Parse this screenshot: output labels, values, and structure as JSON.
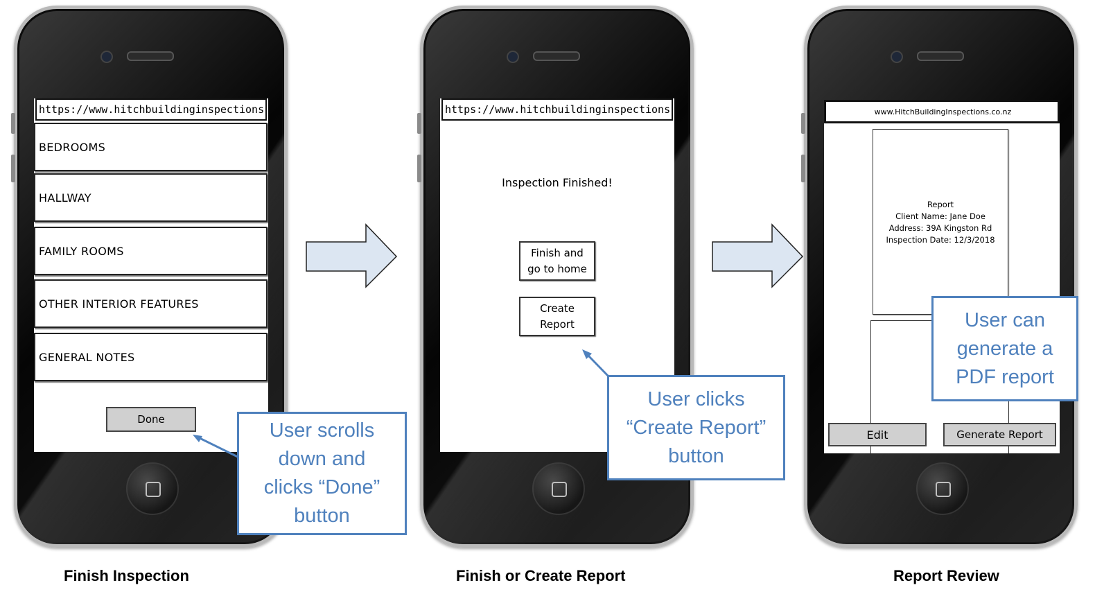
{
  "screens": [
    {
      "caption": "Finish Inspection",
      "url": "https://www.hitchbuildinginspections.co.n",
      "menu_items": [
        "BEDROOMS",
        "HALLWAY",
        "FAMILY ROOMS",
        "OTHER INTERIOR FEATURES",
        "GENERAL NOTES"
      ],
      "done_label": "Done",
      "callout": "User scrolls down and clicks “Done” button"
    },
    {
      "caption": "Finish or Create Report",
      "url": "https://www.hitchbuildinginspections.co.n",
      "status_text": "Inspection Finished!",
      "finish_label": "Finish and go to home",
      "create_label": "Create Report",
      "callout": "User clicks “Create Report” button"
    },
    {
      "caption": "Report Review",
      "url": "www.HitchBuildingInspections.co.nz",
      "report": {
        "title": "Report",
        "client": "Client Name: Jane Doe",
        "address": "Address: 39A Kingston Rd",
        "date": "Inspection Date: 12/3/2018"
      },
      "edit_label": "Edit",
      "generate_label": "Generate Report",
      "callout": "User can generate a PDF report"
    }
  ],
  "colors": {
    "callout_border": "#4f81bd",
    "flow_arrow_fill": "#dce6f2"
  }
}
